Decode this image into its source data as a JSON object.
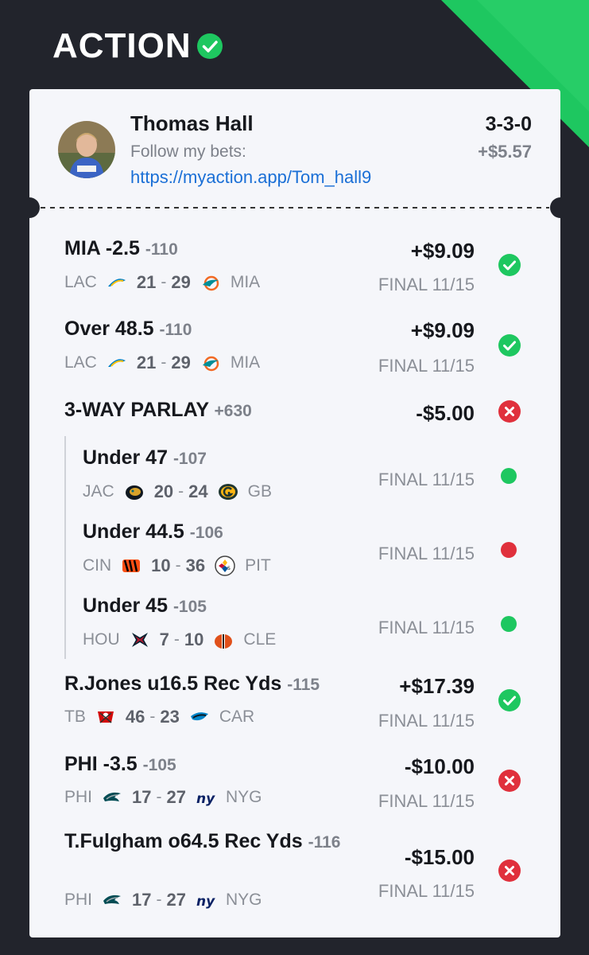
{
  "brand": {
    "name": "ACTION"
  },
  "colors": {
    "accent_green": "#1ec760",
    "loss_red": "#e0303c",
    "link_blue": "#1a6fd6",
    "background": "#22242c"
  },
  "user": {
    "name": "Thomas Hall",
    "follow_text": "Follow my bets:",
    "link": "https://myaction.app/Tom_hall9",
    "record": "3-3-0",
    "profit": "+$5.57"
  },
  "bets": [
    {
      "title": "MIA -2.5",
      "odds": "-110",
      "amount": "+$9.09",
      "status": "won",
      "away": "LAC",
      "away_score": "21",
      "home_score": "29",
      "home": "MIA",
      "final": "FINAL 11/15"
    },
    {
      "title": "Over 48.5",
      "odds": "-110",
      "amount": "+$9.09",
      "status": "won",
      "away": "LAC",
      "away_score": "21",
      "home_score": "29",
      "home": "MIA",
      "final": "FINAL 11/15"
    },
    {
      "title": "3-WAY PARLAY",
      "odds": "+630",
      "amount": "-$5.00",
      "status": "lost"
    },
    {
      "title": "Under 47",
      "odds": "-107",
      "status": "won-leg",
      "away": "JAC",
      "away_score": "20",
      "home_score": "24",
      "home": "GB",
      "final": "FINAL 11/15"
    },
    {
      "title": "Under 44.5",
      "odds": "-106",
      "status": "lost-leg",
      "away": "CIN",
      "away_score": "10",
      "home_score": "36",
      "home": "PIT",
      "final": "FINAL 11/15"
    },
    {
      "title": "Under 45",
      "odds": "-105",
      "status": "won-leg",
      "away": "HOU",
      "away_score": "7",
      "home_score": "10",
      "home": "CLE",
      "final": "FINAL 11/15"
    },
    {
      "title": "R.Jones u16.5 Rec Yds",
      "odds": "-115",
      "amount": "+$17.39",
      "status": "won",
      "away": "TB",
      "away_score": "46",
      "home_score": "23",
      "home": "CAR",
      "final": "FINAL 11/15"
    },
    {
      "title": "PHI -3.5",
      "odds": "-105",
      "amount": "-$10.00",
      "status": "lost",
      "away": "PHI",
      "away_score": "17",
      "home_score": "27",
      "home": "NYG",
      "final": "FINAL 11/15"
    },
    {
      "title": "T.Fulgham o64.5 Rec Yds",
      "odds": "-116",
      "amount": "-$15.00",
      "status": "lost",
      "away": "PHI",
      "away_score": "17",
      "home_score": "27",
      "home": "NYG",
      "final": "FINAL 11/15"
    }
  ],
  "icons": {
    "brand": "check-circle-icon",
    "won": "check-circle-icon",
    "lost": "x-circle-icon",
    "won_leg": "green-dot-icon",
    "lost_leg": "red-dot-icon"
  }
}
